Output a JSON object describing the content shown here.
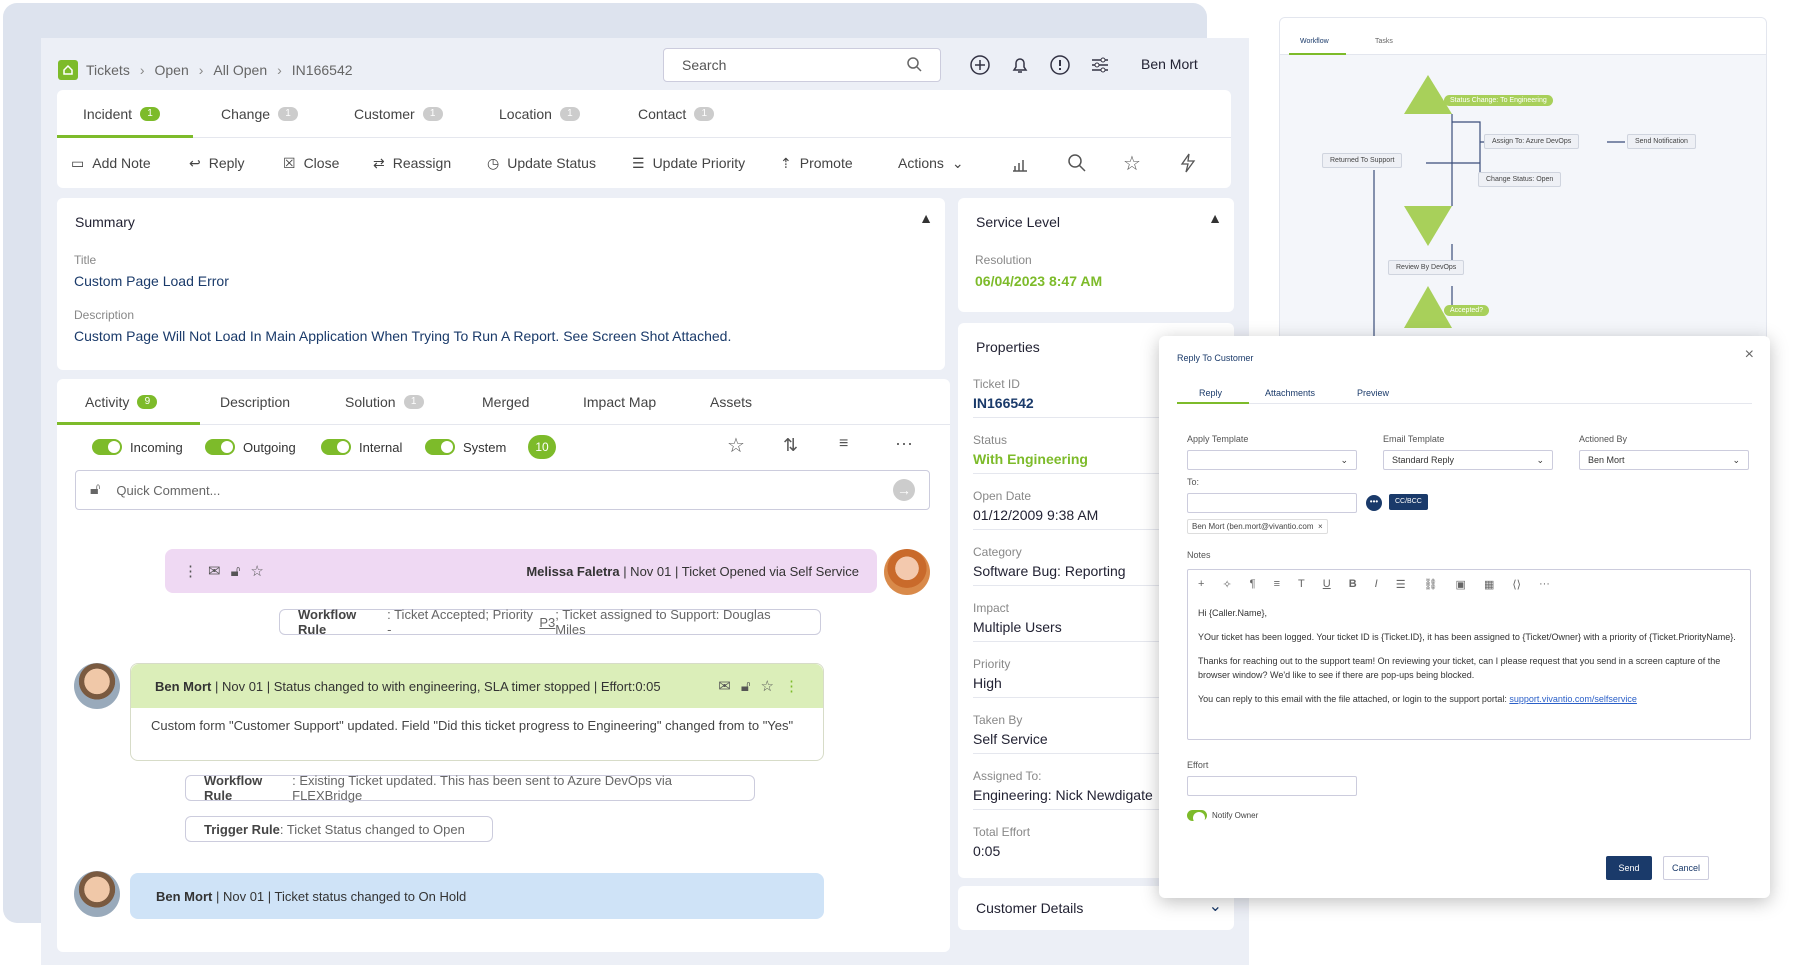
{
  "breadcrumb": [
    "Tickets",
    "Open",
    "All Open",
    "IN166542"
  ],
  "search": {
    "placeholder": "Search"
  },
  "user": {
    "name": "Ben Mort"
  },
  "tabs": [
    {
      "label": "Incident",
      "count": "1"
    },
    {
      "label": "Change",
      "count": "1"
    },
    {
      "label": "Customer",
      "count": "1"
    },
    {
      "label": "Location",
      "count": "1"
    },
    {
      "label": "Contact",
      "count": "1"
    }
  ],
  "toolbar": {
    "add_note": "Add Note",
    "reply": "Reply",
    "close": "Close",
    "reassign": "Reassign",
    "update_status": "Update Status",
    "update_priority": "Update Priority",
    "promote": "Promote",
    "actions": "Actions"
  },
  "summary": {
    "header": "Summary",
    "title_label": "Title",
    "title": "Custom Page Load Error",
    "desc_label": "Description",
    "description": "Custom Page Will Not Load In Main Application When Trying To Run A Report. See Screen Shot Attached."
  },
  "service_level": {
    "header": "Service Level",
    "label": "Resolution",
    "value": "06/04/2023 8:47 AM"
  },
  "properties": {
    "header": "Properties",
    "items": [
      {
        "label": "Ticket ID",
        "value": "IN166542"
      },
      {
        "label": "Status",
        "value": "With Engineering"
      },
      {
        "label": "Open Date",
        "value": "01/12/2009 9:38 AM"
      },
      {
        "label": "Category",
        "value": "Software Bug: Reporting"
      },
      {
        "label": "Impact",
        "value": "Multiple Users"
      },
      {
        "label": "Priority",
        "value": "High"
      },
      {
        "label": "Taken By",
        "value": "Self Service"
      },
      {
        "label": "Assigned To:",
        "value": "Engineering: Nick Newdigate"
      },
      {
        "label": "Total Effort",
        "value": "0:05"
      }
    ]
  },
  "customer_details": {
    "header": "Customer Details"
  },
  "activity_tabs": [
    {
      "label": "Activity",
      "count": "9"
    },
    {
      "label": "Description"
    },
    {
      "label": "Solution",
      "count": "1"
    },
    {
      "label": "Merged"
    },
    {
      "label": "Impact Map"
    },
    {
      "label": "Assets"
    }
  ],
  "filters": {
    "incoming": "Incoming",
    "outgoing": "Outgoing",
    "internal": "Internal",
    "system": "System",
    "count": "10"
  },
  "quick_comment": {
    "placeholder": "Quick Comment..."
  },
  "activity": {
    "m1": {
      "author": "Melissa Faletra",
      "meta": "|  Nov 01  | Ticket Opened via Self Service"
    },
    "r1": {
      "rule": "Workflow Rule",
      "text": ": Ticket Accepted; Priority - ",
      "p": "P3",
      "text2": "; Ticket assigned to Support: Douglas Miles"
    },
    "m2": {
      "author": "Ben Mort",
      "meta": "|  Nov 01  | Status changed to with engineering, SLA timer stopped  |  Effort:0:05",
      "body": "Custom form \"Customer Support\" updated. Field \"Did this ticket progress to Engineering\" changed from to \"Yes\""
    },
    "r2": {
      "rule": "Workflow Rule",
      "text": ": Existing Ticket updated. This has been sent to Azure DevOps via FLEXBridge"
    },
    "r3": {
      "rule": "Trigger Rule",
      "text": ": Ticket Status changed to Open"
    },
    "m3": {
      "author": "Ben Mort",
      "meta": "|  Nov 01  | Ticket status changed to On Hold"
    }
  },
  "workflow": {
    "tabs": [
      "Workflow",
      "Tasks"
    ],
    "nodes": {
      "status_change": "Status Change: To Engineering",
      "assign": "Assign To: Azure DevOps",
      "notify": "Send Notification",
      "returned": "Returned To Support",
      "change_status": "Change Status: Open",
      "review": "Review By DevOps",
      "accepted": "Accepted?"
    }
  },
  "reply": {
    "title": "Reply To Customer",
    "tabs": [
      "Reply",
      "Attachments",
      "Preview"
    ],
    "apply_template_label": "Apply Template",
    "apply_template_value": "",
    "email_template_label": "Email Template",
    "email_template_value": "Standard Reply",
    "actioned_by_label": "Actioned By",
    "actioned_by_value": "Ben Mort",
    "to_label": "To:",
    "cc_label": "CC/BCC",
    "recipient": "Ben Mort (ben.mort@vivantio.com",
    "notes_label": "Notes",
    "body": [
      "Hi {Caller.Name},",
      "YOur ticket has been logged. Your ticket ID is {Ticket.ID}, it has been assigned to {Ticket/Owner} with a priority of {Ticket.PriorityName}.",
      "Thanks for reaching out to the support team! On reviewing  your ticket, can I please request that you send in a screen capture of the browser window? We'd like to see if there are pop-ups being blocked."
    ],
    "body_last": "You can reply to this email with the file attached, or login to the support portal: ",
    "link": "support.vivantio.com/selfservice",
    "effort_label": "Effort",
    "notify_owner": "Notify Owner",
    "send": "Send",
    "cancel": "Cancel"
  }
}
